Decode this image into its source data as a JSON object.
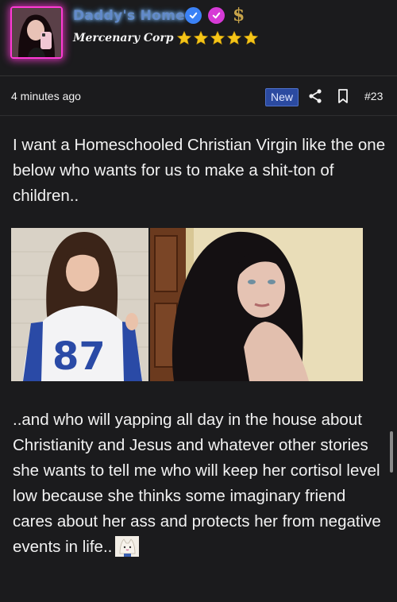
{
  "user": {
    "name": "Daddy's Home",
    "rank": "Mercenary Corp",
    "badges": [
      "verified-blue-icon",
      "verified-pink-icon",
      "dollar-icon"
    ],
    "star_rating": 5
  },
  "meta": {
    "timestamp": "4 minutes ago",
    "new_label": "New",
    "post_number": "#23"
  },
  "post": {
    "paragraph1": "I want a Homeschooled Christian Virgin like the one below who wants for us to make a shit-ton of children..",
    "paragraph2": "..and who will yapping all day in the house about Christianity and Jesus and whatever other stories she wants to tell me who will keep her cortisol level low because she thinks some imaginary friend cares about her ass and protects her from negative events in life..",
    "jersey_number": "87"
  },
  "colors": {
    "background": "#1b1b1d",
    "avatar_glow": "#ff3ad6",
    "name_glow": "#6f9ee8",
    "new_badge": "#2b4aa0",
    "star": "#f5c518"
  }
}
